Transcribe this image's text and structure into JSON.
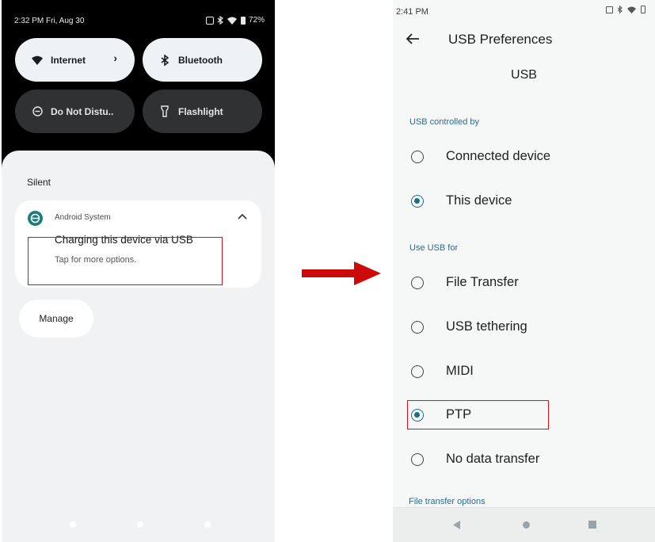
{
  "left_screen": {
    "status_bar": {
      "time_date": "2:32 PM  Fri, Aug 30",
      "battery": "72%"
    },
    "quick_tiles": [
      {
        "label": "Internet",
        "icon": "wifi-icon",
        "state": "on",
        "has_chevron": true
      },
      {
        "label": "Bluetooth",
        "icon": "bluetooth-icon",
        "state": "on"
      },
      {
        "label": "Do Not Distu..",
        "icon": "do-not-disturb-icon",
        "state": "off"
      },
      {
        "label": "Flashlight",
        "icon": "flashlight-icon",
        "state": "off"
      }
    ],
    "section_label": "Silent",
    "notification": {
      "app": "Android System",
      "title": "Charging this device via USB",
      "subtitle": "Tap for more options."
    },
    "manage_label": "Manage"
  },
  "right_screen": {
    "status_bar": {
      "time": "2:41 PM"
    },
    "title": "USB Preferences",
    "section_header": "USB",
    "group1": {
      "label": "USB controlled by",
      "options": [
        {
          "label": "Connected device",
          "checked": false
        },
        {
          "label": "This device",
          "checked": true
        }
      ]
    },
    "group2": {
      "label": "Use USB for",
      "options": [
        {
          "label": "File Transfer",
          "checked": false
        },
        {
          "label": "USB tethering",
          "checked": false
        },
        {
          "label": "MIDI",
          "checked": false
        },
        {
          "label": "PTP",
          "checked": true
        },
        {
          "label": "No data transfer",
          "checked": false
        }
      ]
    },
    "peek_text": "File transfer options"
  },
  "colors": {
    "highlight": "#e0101a",
    "arrow": "#cc0a0a",
    "accent": "#1a6e86",
    "category": "#2a6a8d"
  }
}
